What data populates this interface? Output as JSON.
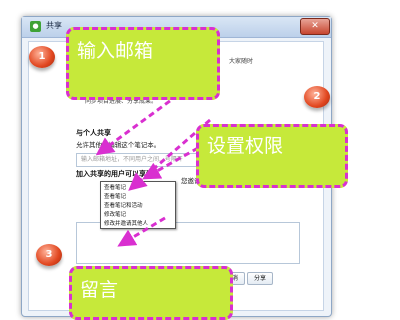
{
  "window": {
    "title": "共享",
    "close_glyph": "✕"
  },
  "dialog": {
    "header_hint": "大家随时",
    "header_desc": "同步项目进展、分享成果。",
    "section_people": "与个人共享",
    "allow_text": "允许其他...编辑这个笔记本。",
    "email_placeholder": "输入邮箱地址，不同用户之间...号隔开",
    "add_people_label": "加入共享的用户可以享受：",
    "permission_hint": "您邀请人只能查看笔记",
    "permission_options": [
      "查看笔记",
      "查看笔记",
      "查看笔记和活动",
      "修改笔记",
      "修改并邀请其他人"
    ],
    "cancel_label": "取消",
    "share_label": "分享"
  },
  "callouts": {
    "email": "输入邮箱",
    "permission": "设置权限",
    "message": "留言"
  },
  "markers": [
    "1",
    "2",
    "3"
  ],
  "colors": {
    "callout_fill": "#c6e93a",
    "callout_border": "#d92fd0",
    "marker": "#e1461f",
    "arrow": "#d92fd0"
  }
}
